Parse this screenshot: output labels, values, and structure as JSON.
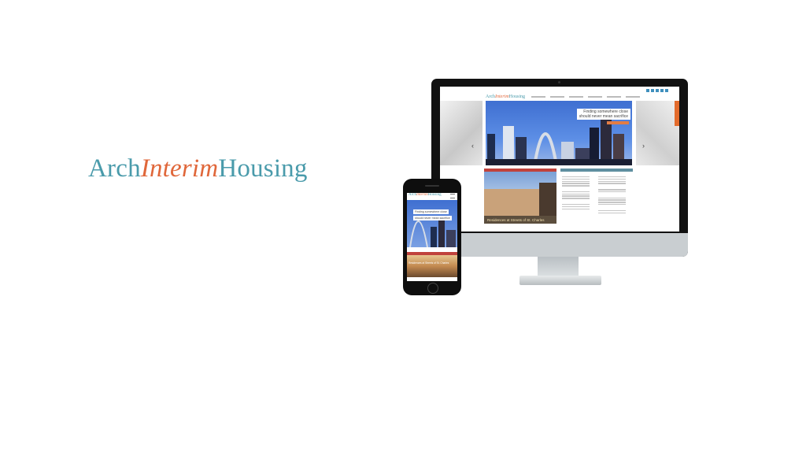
{
  "brand": {
    "part1": "Arch",
    "part2": "Interim",
    "part3": "Housing"
  },
  "desktop": {
    "hero_line1": "Finding somewhere close",
    "hero_line2": "should never mean sacrifice",
    "prev_arrow": "‹",
    "next_arrow": "›",
    "photo_caption": "Residences at Streets of St. Charles"
  },
  "mobile": {
    "hero_line1": "Finding somewhere close",
    "hero_line2": "should never mean sacrifice",
    "photo_caption": "Residences at Streets of St. Charles"
  },
  "colors": {
    "teal": "#4a9bab",
    "orange": "#e0673a",
    "red_band": "#c0423c"
  }
}
